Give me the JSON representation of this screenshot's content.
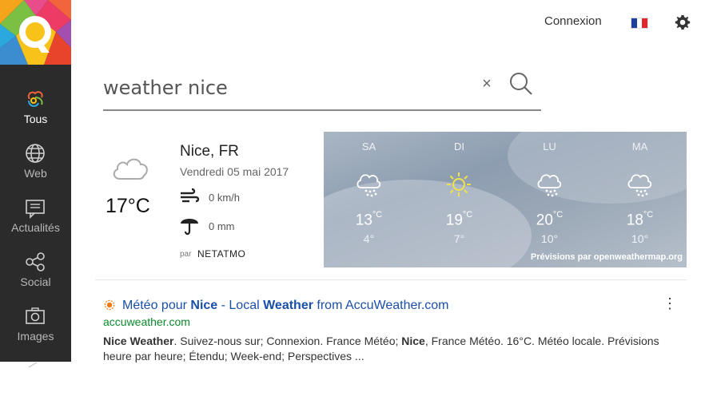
{
  "colors": {
    "sidebar": "#2b2b2b",
    "link": "#1a4fa8",
    "url": "#0d8a2c",
    "accent": "#f07a14"
  },
  "sidebar": {
    "logo": "qwant-logo",
    "items": [
      {
        "label": "Tous",
        "icon": "all-icon",
        "active": true
      },
      {
        "label": "Web",
        "icon": "globe-icon",
        "active": false
      },
      {
        "label": "Actualités",
        "icon": "news-icon",
        "active": false
      },
      {
        "label": "Social",
        "icon": "social-icon",
        "active": false
      },
      {
        "label": "Images",
        "icon": "camera-icon",
        "active": false
      }
    ]
  },
  "header": {
    "login": "Connexion",
    "language_flag": "flag-fr-icon",
    "settings_icon": "gear-icon"
  },
  "search": {
    "value": "weather nice",
    "clear_icon": "close-icon",
    "search_icon": "search-icon"
  },
  "weather": {
    "current_icon": "cloud-icon",
    "temperature": "17°C",
    "city": "Nice, FR",
    "date": "Vendredi 05 mai 2017",
    "wind": "0 km/h",
    "rain": "0 mm",
    "by_label": "par",
    "provider": "NETATMO",
    "forecast": [
      {
        "day": "SA",
        "icon": "rain-cloud-icon",
        "high": "13",
        "unit": "°C",
        "low": "4°"
      },
      {
        "day": "DI",
        "icon": "sun-icon",
        "high": "19",
        "unit": "°C",
        "low": "7°"
      },
      {
        "day": "LU",
        "icon": "rain-cloud-icon",
        "high": "20",
        "unit": "°C",
        "low": "10°"
      },
      {
        "day": "MA",
        "icon": "rain-cloud-icon",
        "high": "18",
        "unit": "°C",
        "low": "10°"
      }
    ],
    "forecast_source": "Prévisions par openweathermap.org"
  },
  "result": {
    "title_parts": [
      "Météo pour ",
      "Nice",
      " - Local ",
      "Weather",
      " from AccuWeather.com"
    ],
    "url": "accuweather.com",
    "snippet_parts": [
      "Nice Weather",
      ". Suivez-nous sur; Connexion. France Météo; ",
      "Nice",
      ", France Météo. 16°C. Météo locale. Prévisions heure par heure; Étendu; Week-end; Perspectives ..."
    ],
    "menu_icon": "more-vertical-icon"
  }
}
